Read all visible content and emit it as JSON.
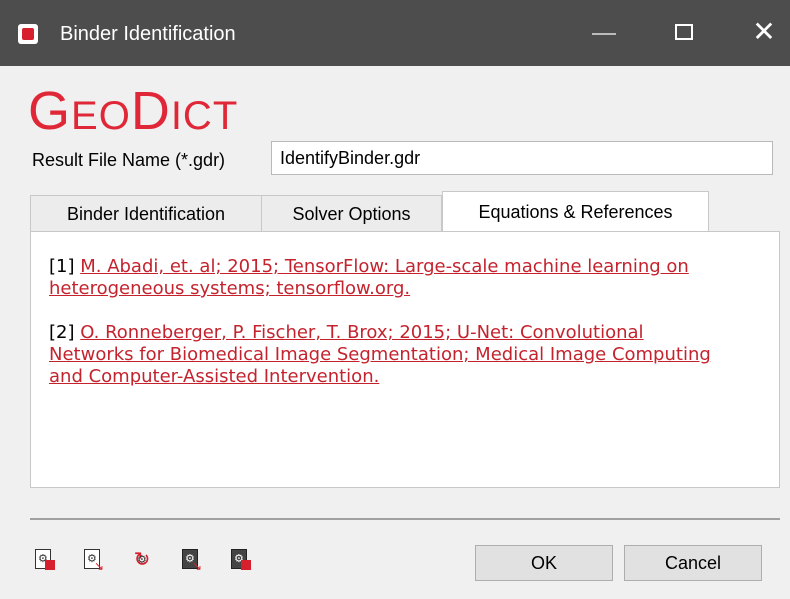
{
  "window": {
    "title": "Binder Identification",
    "close_glyph": "✕"
  },
  "logo": {
    "text_g": "G",
    "text_eo": "EO",
    "text_d": "D",
    "text_ict": "ICT"
  },
  "result_file": {
    "label": "Result File Name (*.gdr)",
    "value": "IdentifyBinder.gdr"
  },
  "tabs": [
    {
      "label": "Binder Identification"
    },
    {
      "label": "Solver Options"
    },
    {
      "label": "Equations & References",
      "active": true
    }
  ],
  "references": [
    {
      "prefix": "[1] ",
      "line1": "M. Abadi, et. al; 2015; TensorFlow: Large-scale machine learning on",
      "line2": "heterogeneous systems; tensorflow.org."
    },
    {
      "prefix": "[2] ",
      "line1": "O. Ronneberger, P. Fischer, T. Brox; 2015; U-Net: Convolutional",
      "line2": "Networks for Biomedical Image Segmentation; Medical Image Computing",
      "line3": "and Computer-Assisted Intervention."
    }
  ],
  "toolbar_icons": [
    "save-settings-icon",
    "load-settings-icon",
    "reset-settings-icon",
    "save-dark-icon",
    "export-dark-icon"
  ],
  "buttons": {
    "ok": "OK",
    "cancel": "Cancel"
  },
  "colors": {
    "accent": "#e02737",
    "link": "#c4232e",
    "titlebar": "#4d4d4d"
  }
}
